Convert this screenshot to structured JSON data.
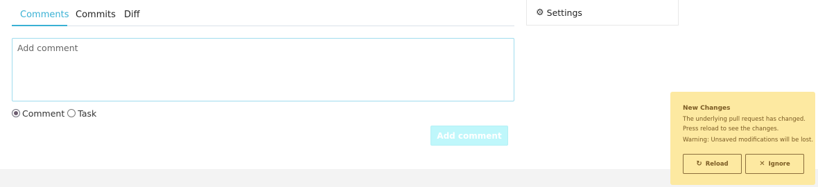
{
  "tabs": [
    {
      "label": "Comments"
    },
    {
      "label": "Commits"
    },
    {
      "label": "Diff"
    }
  ],
  "comment": {
    "placeholder": "Add comment",
    "value": ""
  },
  "comment_type": {
    "options": [
      {
        "label": "Comment",
        "selected": true
      },
      {
        "label": "Task",
        "selected": false
      }
    ]
  },
  "actions": {
    "add_comment_label": "Add comment"
  },
  "settings": {
    "label": "Settings",
    "icon": "gear-icon"
  },
  "notification": {
    "title": "New Changes",
    "message_line1": "The underlying pull request has changed.",
    "message_line2": "Press reload to see the changes.",
    "warning": "Warning: Unsaved modifications will be lost.",
    "reload_label": "Reload",
    "ignore_label": "Ignore",
    "background_color": "#fde9a1"
  },
  "colors": {
    "accent": "#39b1d4",
    "disabled_button": "#bff7fb"
  }
}
